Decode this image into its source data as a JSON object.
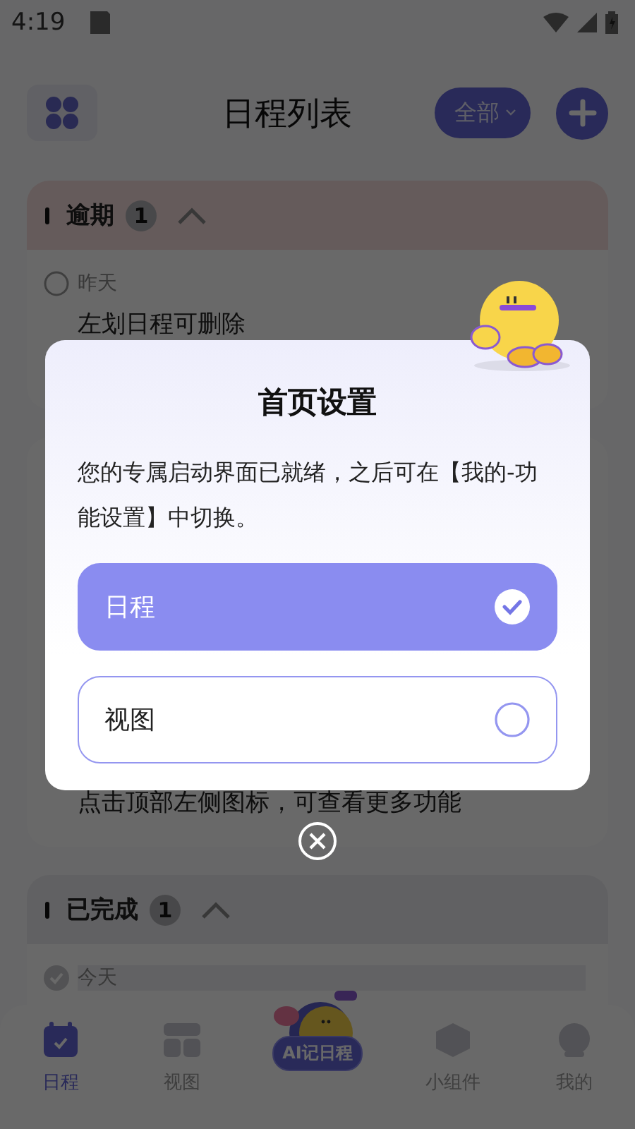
{
  "status_bar": {
    "time": "4:19"
  },
  "header": {
    "title": "日程列表",
    "filter": "全部"
  },
  "sections": [
    {
      "kind": "overdue",
      "title": "逾期",
      "count": "1",
      "expanded": true,
      "items": [
        {
          "date": "昨天",
          "title": "左划日程可删除",
          "done": false
        }
      ]
    },
    {
      "kind": "plain",
      "items": [
        {
          "title": "点击顶部左侧图标，可查看更多功能"
        }
      ]
    },
    {
      "kind": "completed",
      "title": "已完成",
      "count": "1",
      "expanded": true,
      "items": [
        {
          "date": "今天",
          "done": true
        }
      ]
    }
  ],
  "bottom_nav": [
    {
      "kind": "tab",
      "label": "日程",
      "selected": true
    },
    {
      "kind": "tab",
      "label": "视图",
      "selected": false
    },
    {
      "kind": "ai",
      "label": "AI记日程"
    },
    {
      "kind": "tab",
      "label": "小组件",
      "selected": false
    },
    {
      "kind": "tab",
      "label": "我的",
      "selected": false
    }
  ],
  "dialog": {
    "title": "首页设置",
    "message": "您的专属启动界面已就绪，之后可在【我的-功能设置】中切换。",
    "options": [
      {
        "label": "日程",
        "selected": true
      },
      {
        "label": "视图",
        "selected": false
      }
    ]
  }
}
